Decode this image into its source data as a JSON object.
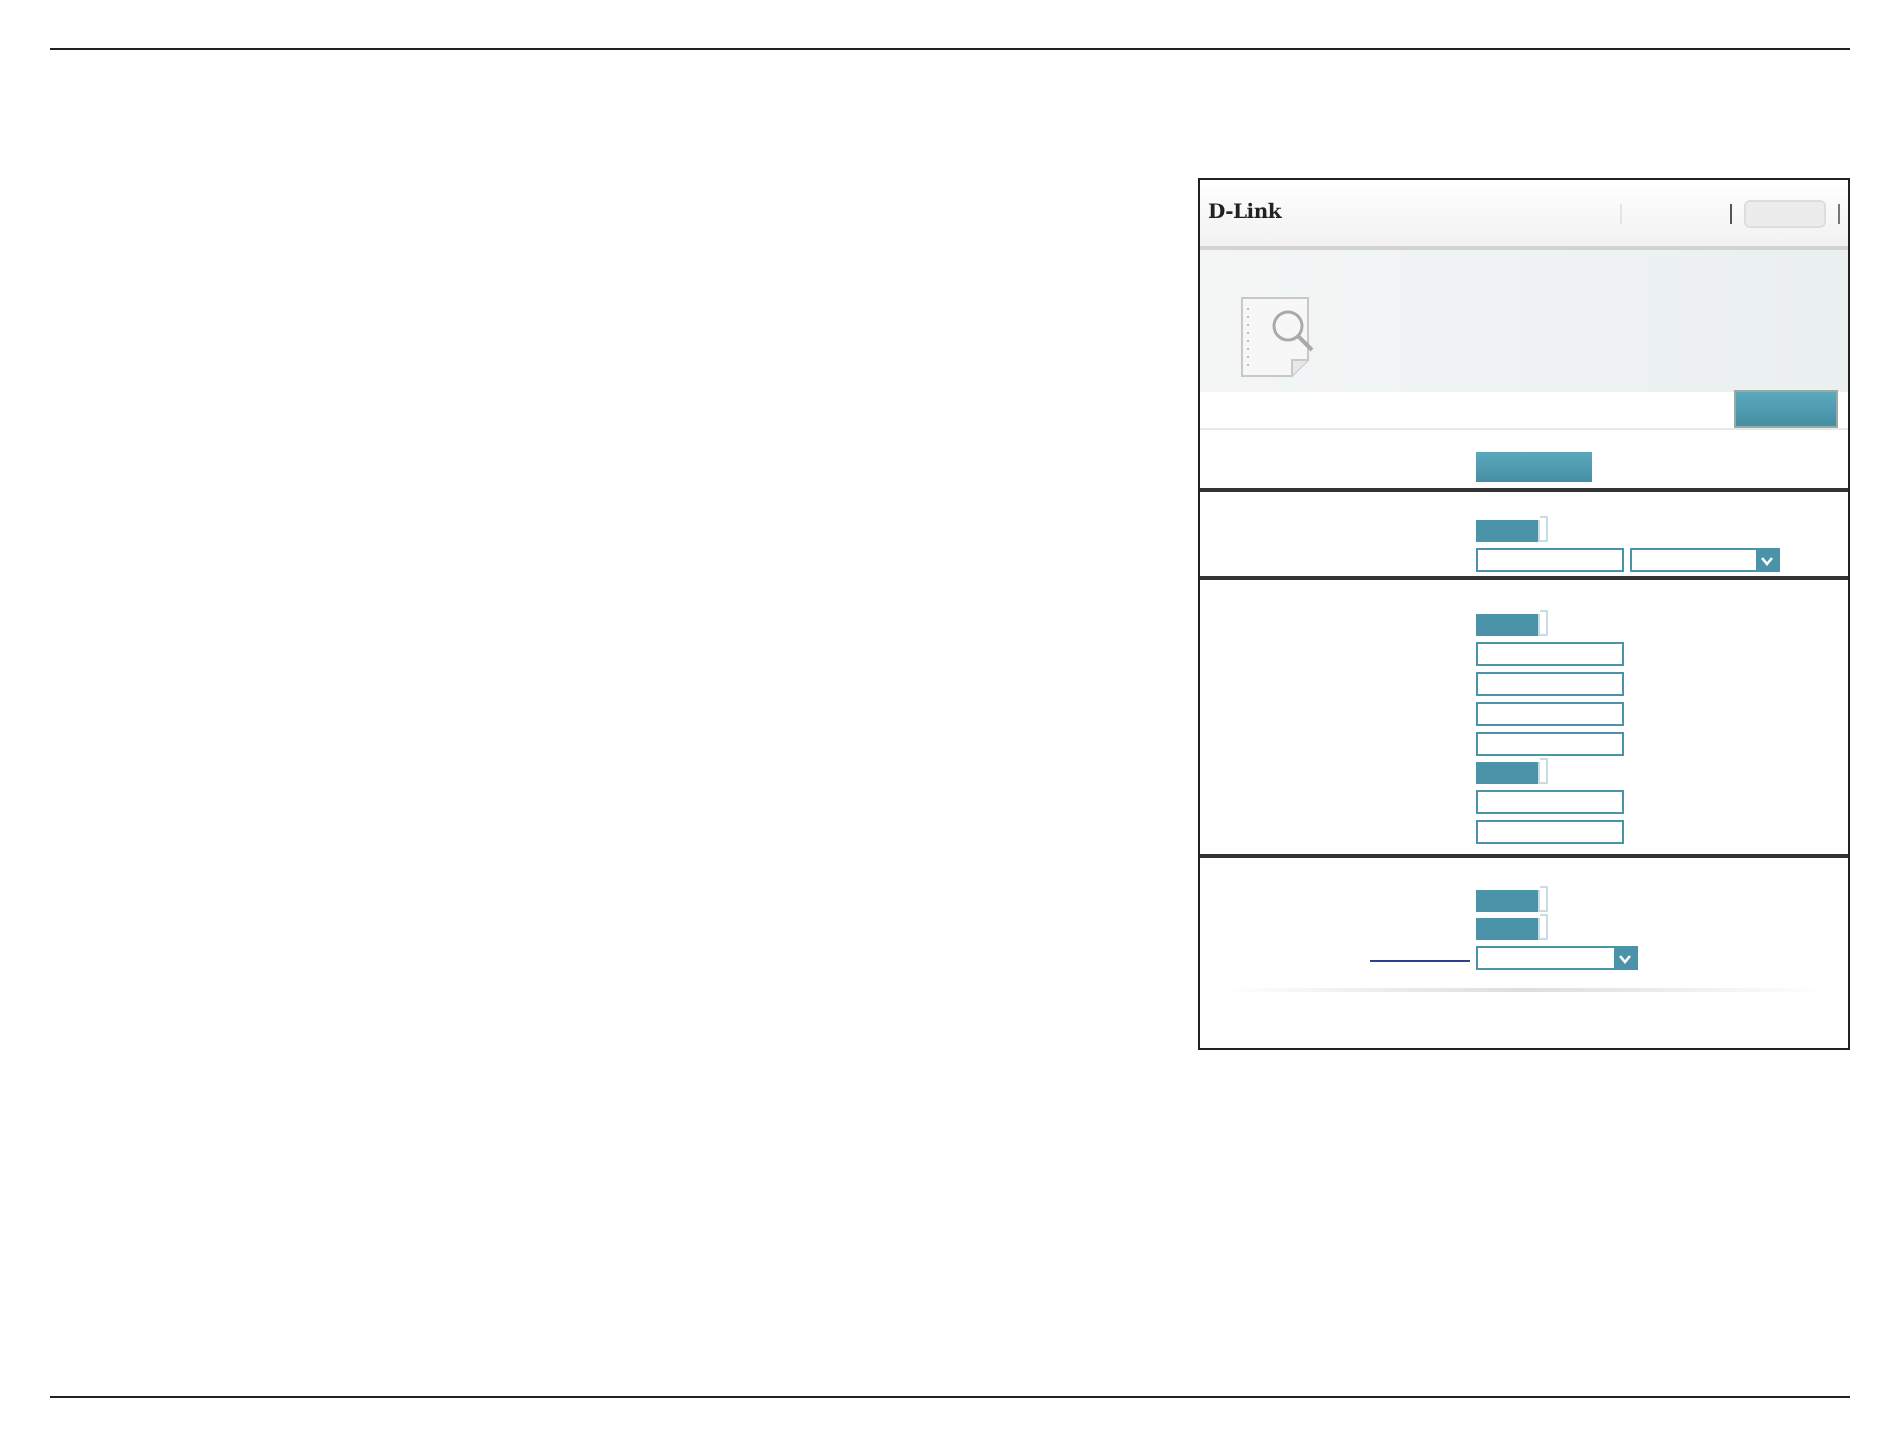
{
  "logo": "D-Link",
  "sections": [
    {
      "controls": [
        {
          "kind": "button"
        }
      ]
    },
    {
      "controls": [
        {
          "kind": "toggle",
          "on": true
        },
        {
          "kind": "field-select"
        }
      ]
    },
    {
      "controls": [
        {
          "kind": "toggle",
          "on": true
        },
        {
          "kind": "field"
        },
        {
          "kind": "field"
        },
        {
          "kind": "field"
        },
        {
          "kind": "field"
        },
        {
          "kind": "toggle",
          "on": true
        },
        {
          "kind": "field"
        },
        {
          "kind": "field"
        }
      ]
    },
    {
      "controls": [
        {
          "kind": "toggle",
          "on": true
        },
        {
          "kind": "toggle",
          "on": true
        },
        {
          "kind": "link-select"
        }
      ]
    }
  ]
}
